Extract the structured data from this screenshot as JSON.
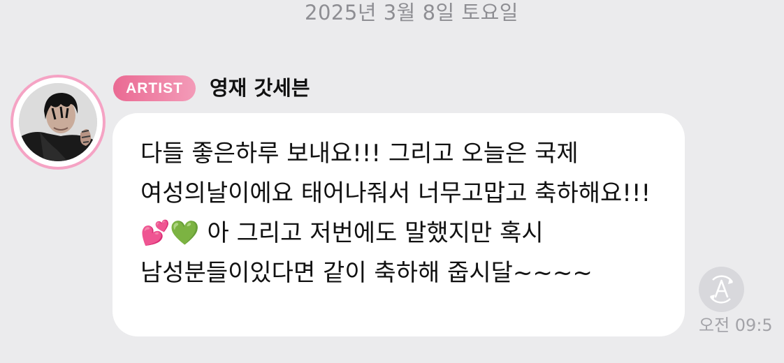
{
  "date_header": "2025년 3월 8일 토요일",
  "sender": {
    "badge": "ARTIST",
    "name": "영재 갓세븐"
  },
  "message": {
    "text": " 다들 좋은하루 보내요!!! 그리고 오늘은 국제 여성의날이에요 태어나줘서 너무고맙고 축하해요!!! 💕💚 아 그리고 저번에도 말했지만 혹시 남성분들이있다면 같이 축하해 줍시달~~~~",
    "timestamp": "오전 09:5"
  },
  "colors": {
    "background": "#ebebed",
    "bubble": "#ffffff",
    "badge_start": "#ea6a93",
    "badge_end": "#f39bb8",
    "avatar_ring": "#f5a3c4"
  },
  "icons": {
    "avatar": "artist-profile-photo",
    "translate": "translate-a-icon"
  }
}
